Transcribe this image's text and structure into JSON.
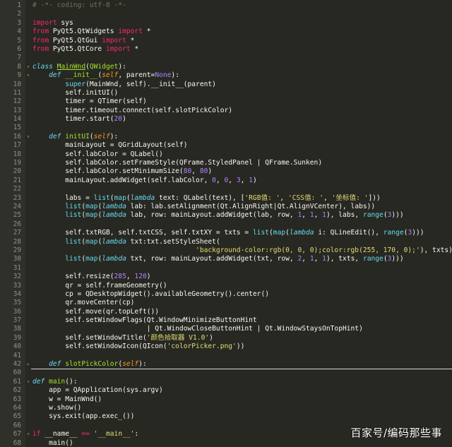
{
  "editor": {
    "theme_colors": {
      "background": "#272822",
      "keyword": "#f92672",
      "def_keyword": "#66d9ef",
      "function_name": "#a6e22e",
      "string": "#e6db74",
      "number": "#ae81ff",
      "comment": "#75715e",
      "self": "#fd971f"
    },
    "lines": [
      {
        "no": "1",
        "fold": "",
        "tokens": [
          {
            "t": "# -*- coding: utf-8 -*-",
            "c": "cm"
          }
        ]
      },
      {
        "no": "2",
        "fold": "",
        "tokens": []
      },
      {
        "no": "3",
        "fold": "",
        "tokens": [
          {
            "t": "import",
            "c": "kw"
          },
          {
            "t": " sys",
            "c": "n"
          }
        ]
      },
      {
        "no": "4",
        "fold": "",
        "tokens": [
          {
            "t": "from",
            "c": "kw"
          },
          {
            "t": " PyQt5.QtWidgets ",
            "c": "n"
          },
          {
            "t": "import",
            "c": "kw"
          },
          {
            "t": " *",
            "c": "n"
          }
        ]
      },
      {
        "no": "5",
        "fold": "",
        "tokens": [
          {
            "t": "from",
            "c": "kw"
          },
          {
            "t": " PyQt5.QtGui ",
            "c": "n"
          },
          {
            "t": "import",
            "c": "kw"
          },
          {
            "t": " *",
            "c": "n"
          }
        ]
      },
      {
        "no": "6",
        "fold": "",
        "tokens": [
          {
            "t": "from",
            "c": "kw"
          },
          {
            "t": " PyQt5.QtCore ",
            "c": "n"
          },
          {
            "t": "import",
            "c": "kw"
          },
          {
            "t": " *",
            "c": "n"
          }
        ]
      },
      {
        "no": "7",
        "fold": "",
        "tokens": []
      },
      {
        "no": "8",
        "fold": "▾",
        "tokens": [
          {
            "t": "class",
            "c": "def"
          },
          {
            "t": " ",
            "c": "n"
          },
          {
            "t": "MainWnd",
            "c": "cls"
          },
          {
            "t": "(",
            "c": "n"
          },
          {
            "t": "QWidget",
            "c": "fn"
          },
          {
            "t": "):",
            "c": "n"
          }
        ]
      },
      {
        "no": "9",
        "fold": "▾",
        "tokens": [
          {
            "t": "    ",
            "c": "n"
          },
          {
            "t": "def",
            "c": "def"
          },
          {
            "t": " ",
            "c": "n"
          },
          {
            "t": "__init__",
            "c": "fn"
          },
          {
            "t": "(",
            "c": "n"
          },
          {
            "t": "self",
            "c": "self"
          },
          {
            "t": ", parent=",
            "c": "n"
          },
          {
            "t": "None",
            "c": "num"
          },
          {
            "t": "):",
            "c": "n"
          }
        ]
      },
      {
        "no": "10",
        "fold": "",
        "tokens": [
          {
            "t": "        ",
            "c": "n"
          },
          {
            "t": "super",
            "c": "bi"
          },
          {
            "t": "(MainWnd, self).__init__(parent)",
            "c": "n"
          }
        ]
      },
      {
        "no": "11",
        "fold": "",
        "tokens": [
          {
            "t": "        self.initUI()",
            "c": "n"
          }
        ]
      },
      {
        "no": "12",
        "fold": "",
        "tokens": [
          {
            "t": "        timer = QTimer(self)",
            "c": "n"
          }
        ]
      },
      {
        "no": "13",
        "fold": "",
        "tokens": [
          {
            "t": "        timer.timeout.connect(self.slotPickColor)",
            "c": "n"
          }
        ]
      },
      {
        "no": "14",
        "fold": "",
        "tokens": [
          {
            "t": "        timer.start(",
            "c": "n"
          },
          {
            "t": "20",
            "c": "num"
          },
          {
            "t": ")",
            "c": "n"
          }
        ]
      },
      {
        "no": "15",
        "fold": "",
        "tokens": []
      },
      {
        "no": "16",
        "fold": "▾",
        "tokens": [
          {
            "t": "    ",
            "c": "n"
          },
          {
            "t": "def",
            "c": "def"
          },
          {
            "t": " ",
            "c": "n"
          },
          {
            "t": "initUI",
            "c": "fn"
          },
          {
            "t": "(",
            "c": "n"
          },
          {
            "t": "self",
            "c": "self"
          },
          {
            "t": "):",
            "c": "n"
          }
        ]
      },
      {
        "no": "17",
        "fold": "",
        "tokens": [
          {
            "t": "        mainLayout = QGridLayout(self)",
            "c": "n"
          }
        ]
      },
      {
        "no": "18",
        "fold": "",
        "tokens": [
          {
            "t": "        self.labColor = QLabel()",
            "c": "n"
          }
        ]
      },
      {
        "no": "19",
        "fold": "",
        "tokens": [
          {
            "t": "        self.labColor.setFrameStyle(QFrame.StyledPanel | QFrame.Sunken)",
            "c": "n"
          }
        ]
      },
      {
        "no": "20",
        "fold": "",
        "tokens": [
          {
            "t": "        self.labColor.setMinimumSize(",
            "c": "n"
          },
          {
            "t": "80",
            "c": "num"
          },
          {
            "t": ", ",
            "c": "n"
          },
          {
            "t": "80",
            "c": "num"
          },
          {
            "t": ")",
            "c": "n"
          }
        ]
      },
      {
        "no": "21",
        "fold": "",
        "tokens": [
          {
            "t": "        mainLayout.addWidget(self.labColor, ",
            "c": "n"
          },
          {
            "t": "0",
            "c": "num"
          },
          {
            "t": ", ",
            "c": "n"
          },
          {
            "t": "0",
            "c": "num"
          },
          {
            "t": ", ",
            "c": "n"
          },
          {
            "t": "3",
            "c": "num"
          },
          {
            "t": ", ",
            "c": "n"
          },
          {
            "t": "1",
            "c": "num"
          },
          {
            "t": ")",
            "c": "n"
          }
        ]
      },
      {
        "no": "22",
        "fold": "",
        "tokens": []
      },
      {
        "no": "23",
        "fold": "",
        "tokens": [
          {
            "t": "        labs = ",
            "c": "n"
          },
          {
            "t": "list",
            "c": "bi"
          },
          {
            "t": "(",
            "c": "n"
          },
          {
            "t": "map",
            "c": "bi"
          },
          {
            "t": "(",
            "c": "n"
          },
          {
            "t": "lambda",
            "c": "def"
          },
          {
            "t": " text: QLabel(text), [",
            "c": "n"
          },
          {
            "t": "'RGB值: '",
            "c": "str"
          },
          {
            "t": ", ",
            "c": "n"
          },
          {
            "t": "'CSS值: '",
            "c": "str"
          },
          {
            "t": ", ",
            "c": "n"
          },
          {
            "t": "'坐标值: '",
            "c": "str"
          },
          {
            "t": "]))",
            "c": "n"
          }
        ]
      },
      {
        "no": "24",
        "fold": "",
        "tokens": [
          {
            "t": "        ",
            "c": "n"
          },
          {
            "t": "list",
            "c": "bi"
          },
          {
            "t": "(",
            "c": "n"
          },
          {
            "t": "map",
            "c": "bi"
          },
          {
            "t": "(",
            "c": "n"
          },
          {
            "t": "lambda",
            "c": "def"
          },
          {
            "t": " lab: lab.setAlignment(Qt.AlignRight|Qt.AlignVCenter), labs))",
            "c": "n"
          }
        ]
      },
      {
        "no": "25",
        "fold": "",
        "tokens": [
          {
            "t": "        ",
            "c": "n"
          },
          {
            "t": "list",
            "c": "bi"
          },
          {
            "t": "(",
            "c": "n"
          },
          {
            "t": "map",
            "c": "bi"
          },
          {
            "t": "(",
            "c": "n"
          },
          {
            "t": "lambda",
            "c": "def"
          },
          {
            "t": " lab, row: mainLayout.addWidget(lab, row, ",
            "c": "n"
          },
          {
            "t": "1",
            "c": "num"
          },
          {
            "t": ", ",
            "c": "n"
          },
          {
            "t": "1",
            "c": "num"
          },
          {
            "t": ", ",
            "c": "n"
          },
          {
            "t": "1",
            "c": "num"
          },
          {
            "t": "), labs, ",
            "c": "n"
          },
          {
            "t": "range",
            "c": "bi"
          },
          {
            "t": "(",
            "c": "n"
          },
          {
            "t": "3",
            "c": "num"
          },
          {
            "t": ")))",
            "c": "n"
          }
        ]
      },
      {
        "no": "26",
        "fold": "",
        "tokens": []
      },
      {
        "no": "27",
        "fold": "",
        "tokens": [
          {
            "t": "        self.txtRGB, self.txtCSS, self.txtXY = txts = ",
            "c": "n"
          },
          {
            "t": "list",
            "c": "bi"
          },
          {
            "t": "(",
            "c": "n"
          },
          {
            "t": "map",
            "c": "bi"
          },
          {
            "t": "(",
            "c": "n"
          },
          {
            "t": "lambda",
            "c": "def"
          },
          {
            "t": " i: QLineEdit(), ",
            "c": "n"
          },
          {
            "t": "range",
            "c": "bi"
          },
          {
            "t": "(",
            "c": "n"
          },
          {
            "t": "3",
            "c": "num"
          },
          {
            "t": ")))",
            "c": "n"
          }
        ]
      },
      {
        "no": "28",
        "fold": "",
        "tokens": [
          {
            "t": "        ",
            "c": "n"
          },
          {
            "t": "list",
            "c": "bi"
          },
          {
            "t": "(",
            "c": "n"
          },
          {
            "t": "map",
            "c": "bi"
          },
          {
            "t": "(",
            "c": "n"
          },
          {
            "t": "lambda",
            "c": "def"
          },
          {
            "t": " txt:txt.setStyleSheet(",
            "c": "n"
          }
        ]
      },
      {
        "no": "29",
        "fold": "",
        "tokens": [
          {
            "t": "                                        ",
            "c": "n"
          },
          {
            "t": "'background-color:rgb(0, 0, 0);color:rgb(255, 170, 0);'",
            "c": "str"
          },
          {
            "t": "), txts))",
            "c": "n"
          }
        ]
      },
      {
        "no": "30",
        "fold": "",
        "tokens": [
          {
            "t": "        ",
            "c": "n"
          },
          {
            "t": "list",
            "c": "bi"
          },
          {
            "t": "(",
            "c": "n"
          },
          {
            "t": "map",
            "c": "bi"
          },
          {
            "t": "(",
            "c": "n"
          },
          {
            "t": "lambda",
            "c": "def"
          },
          {
            "t": " txt, row: mainLayout.addWidget(txt, row, ",
            "c": "n"
          },
          {
            "t": "2",
            "c": "num"
          },
          {
            "t": ", ",
            "c": "n"
          },
          {
            "t": "1",
            "c": "num"
          },
          {
            "t": ", ",
            "c": "n"
          },
          {
            "t": "1",
            "c": "num"
          },
          {
            "t": "), txts, ",
            "c": "n"
          },
          {
            "t": "range",
            "c": "bi"
          },
          {
            "t": "(",
            "c": "n"
          },
          {
            "t": "3",
            "c": "num"
          },
          {
            "t": ")))",
            "c": "n"
          }
        ]
      },
      {
        "no": "31",
        "fold": "",
        "tokens": []
      },
      {
        "no": "32",
        "fold": "",
        "tokens": [
          {
            "t": "        self.resize(",
            "c": "n"
          },
          {
            "t": "285",
            "c": "num"
          },
          {
            "t": ", ",
            "c": "n"
          },
          {
            "t": "120",
            "c": "num"
          },
          {
            "t": ")",
            "c": "n"
          }
        ]
      },
      {
        "no": "33",
        "fold": "",
        "tokens": [
          {
            "t": "        qr = self.frameGeometry()",
            "c": "n"
          }
        ]
      },
      {
        "no": "34",
        "fold": "",
        "tokens": [
          {
            "t": "        cp = QDesktopWidget().availableGeometry().center()",
            "c": "n"
          }
        ]
      },
      {
        "no": "35",
        "fold": "",
        "tokens": [
          {
            "t": "        qr.moveCenter(cp)",
            "c": "n"
          }
        ]
      },
      {
        "no": "36",
        "fold": "",
        "tokens": [
          {
            "t": "        self.move(qr.topLeft())",
            "c": "n"
          }
        ]
      },
      {
        "no": "37",
        "fold": "",
        "tokens": [
          {
            "t": "        self.setWindowFlags(Qt.WindowMinimizeButtonHint",
            "c": "n"
          }
        ]
      },
      {
        "no": "38",
        "fold": "",
        "tokens": [
          {
            "t": "                            | Qt.WindowCloseButtonHint | Qt.WindowStaysOnTopHint)",
            "c": "n"
          }
        ]
      },
      {
        "no": "39",
        "fold": "",
        "tokens": [
          {
            "t": "        self.setWindowTitle(",
            "c": "n"
          },
          {
            "t": "'颜色拾取器 V1.0'",
            "c": "str"
          },
          {
            "t": ")",
            "c": "n"
          }
        ]
      },
      {
        "no": "40",
        "fold": "",
        "tokens": [
          {
            "t": "        self.setWindowIcon(QIcon(",
            "c": "n"
          },
          {
            "t": "'colorPicker.png'",
            "c": "str"
          },
          {
            "t": "))",
            "c": "n"
          }
        ]
      },
      {
        "no": "41",
        "fold": "",
        "tokens": []
      },
      {
        "no": "42",
        "fold": "▸",
        "tokens": [
          {
            "t": "    ",
            "c": "n"
          },
          {
            "t": "def",
            "c": "def"
          },
          {
            "t": " ",
            "c": "n"
          },
          {
            "t": "slotPickColor",
            "c": "fn"
          },
          {
            "t": "(",
            "c": "n"
          },
          {
            "t": "self",
            "c": "self"
          },
          {
            "t": "):",
            "c": "n"
          }
        ],
        "separator_after": true
      },
      {
        "no": "60",
        "fold": "",
        "tokens": []
      },
      {
        "no": "61",
        "fold": "▾",
        "tokens": [
          {
            "t": "def",
            "c": "def"
          },
          {
            "t": " ",
            "c": "n"
          },
          {
            "t": "main",
            "c": "fn"
          },
          {
            "t": "():",
            "c": "n"
          }
        ]
      },
      {
        "no": "62",
        "fold": "",
        "tokens": [
          {
            "t": "    app = QApplication(sys.argv)",
            "c": "n"
          }
        ]
      },
      {
        "no": "63",
        "fold": "",
        "tokens": [
          {
            "t": "    w = MainWnd()",
            "c": "n"
          }
        ]
      },
      {
        "no": "64",
        "fold": "",
        "tokens": [
          {
            "t": "    w.show()",
            "c": "n"
          }
        ]
      },
      {
        "no": "65",
        "fold": "",
        "tokens": [
          {
            "t": "    sys.exit(app.exec_())",
            "c": "n"
          }
        ]
      },
      {
        "no": "66",
        "fold": "",
        "tokens": []
      },
      {
        "no": "67",
        "fold": "▾",
        "tokens": [
          {
            "t": "if",
            "c": "kw"
          },
          {
            "t": " __name__ ",
            "c": "n"
          },
          {
            "t": "==",
            "c": "kw"
          },
          {
            "t": " ",
            "c": "n"
          },
          {
            "t": "'__main__'",
            "c": "str"
          },
          {
            "t": ":",
            "c": "n"
          }
        ]
      },
      {
        "no": "68",
        "fold": "",
        "tokens": [
          {
            "t": "    main()",
            "c": "n"
          }
        ]
      }
    ]
  },
  "watermark": {
    "text": "百家号/编码那些事"
  }
}
